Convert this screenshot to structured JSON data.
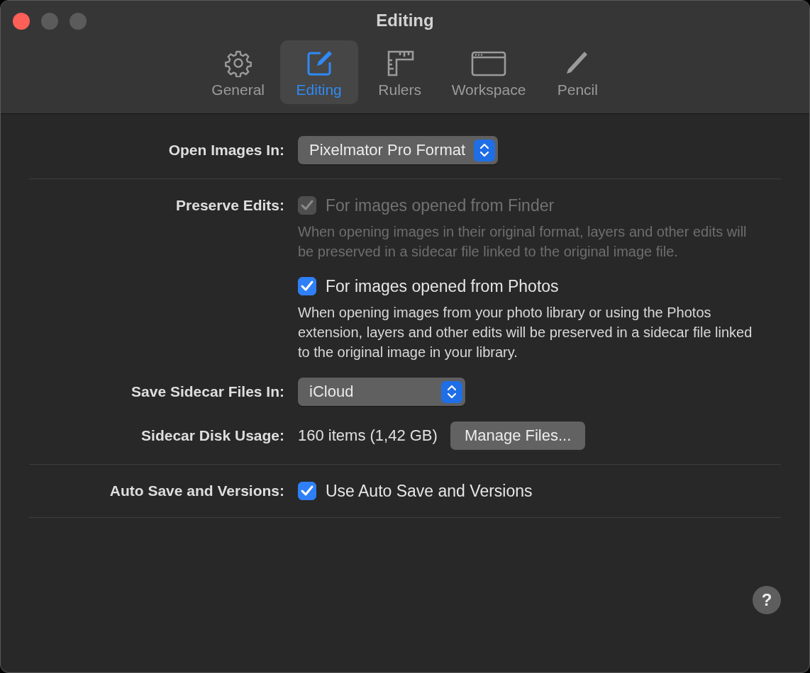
{
  "window": {
    "title": "Editing"
  },
  "tabs": [
    {
      "label": "General",
      "selected": false
    },
    {
      "label": "Editing",
      "selected": true
    },
    {
      "label": "Rulers",
      "selected": false
    },
    {
      "label": "Workspace",
      "selected": false
    },
    {
      "label": "Pencil",
      "selected": false
    }
  ],
  "sections": [
    {
      "rows": [
        {
          "kind": "popup",
          "label": "Open Images In:",
          "value": "Pixelmator Pro Format"
        }
      ]
    },
    {
      "rows": [
        {
          "kind": "checks",
          "label": "Preserve Edits:",
          "options": [
            {
              "text": "For images opened from Finder",
              "checked": true,
              "disabled": true,
              "description": "When opening images in their original format, layers and other edits will be preserved in a sidecar file linked to the original image file."
            },
            {
              "text": "For images opened from Photos",
              "checked": true,
              "disabled": false,
              "description": "When opening images from your photo library or using the Photos extension, layers and other edits will be preserved in a sidecar file linked to the original image in your library."
            }
          ]
        },
        {
          "kind": "popup",
          "label": "Save Sidecar Files In:",
          "value": "iCloud"
        },
        {
          "kind": "usage",
          "label": "Sidecar Disk Usage:",
          "value": "160 items (1,42 GB)",
          "button": "Manage Files..."
        }
      ]
    },
    {
      "rows": [
        {
          "kind": "checks",
          "label": "Auto Save and Versions:",
          "options": [
            {
              "text": "Use Auto Save and Versions",
              "checked": true,
              "disabled": false
            }
          ]
        }
      ]
    }
  ],
  "help_button": "?"
}
